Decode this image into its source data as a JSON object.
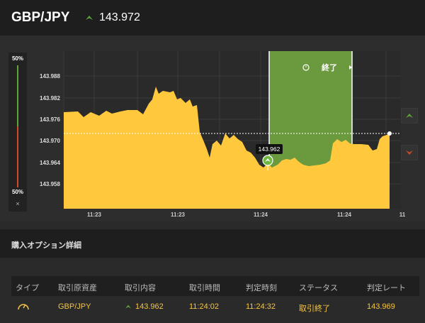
{
  "header": {
    "pair": "GBP/JPY",
    "rate": "143.972",
    "trend_icon": "up-arrow-icon"
  },
  "gauge": {
    "top": "50%",
    "bottom": "50%",
    "close_symbol": "×"
  },
  "chart_data": {
    "type": "area",
    "y_ticks": [
      "143.988",
      "143.982",
      "143.976",
      "143.970",
      "143.964",
      "143.958"
    ],
    "x_ticks": [
      "11:23",
      "11:23",
      "11:24",
      "11:24",
      "11"
    ],
    "current_rate": 143.972,
    "entry_label": "143.962",
    "end_label": "終了",
    "colors": {
      "fill": "#ffc83d",
      "window": "#6a9a3d",
      "call": "#5fa53a",
      "put": "#d14b2a"
    }
  },
  "buttons": {
    "call_icon": "call-up-icon",
    "put_icon": "put-down-icon"
  },
  "section": {
    "title": "購入オプション詳細"
  },
  "table": {
    "headers": [
      "タイプ",
      "取引原資産",
      "取引内容",
      "取引時間",
      "判定時刻",
      "ステータス",
      "判定レート"
    ],
    "row": {
      "type_icon": "gauge-icon",
      "asset": "GBP/JPY",
      "content": "143.962",
      "trade_time": "11:24:02",
      "judge_time": "11:24:32",
      "status": "取引終了",
      "judge_rate": "143.969"
    }
  }
}
